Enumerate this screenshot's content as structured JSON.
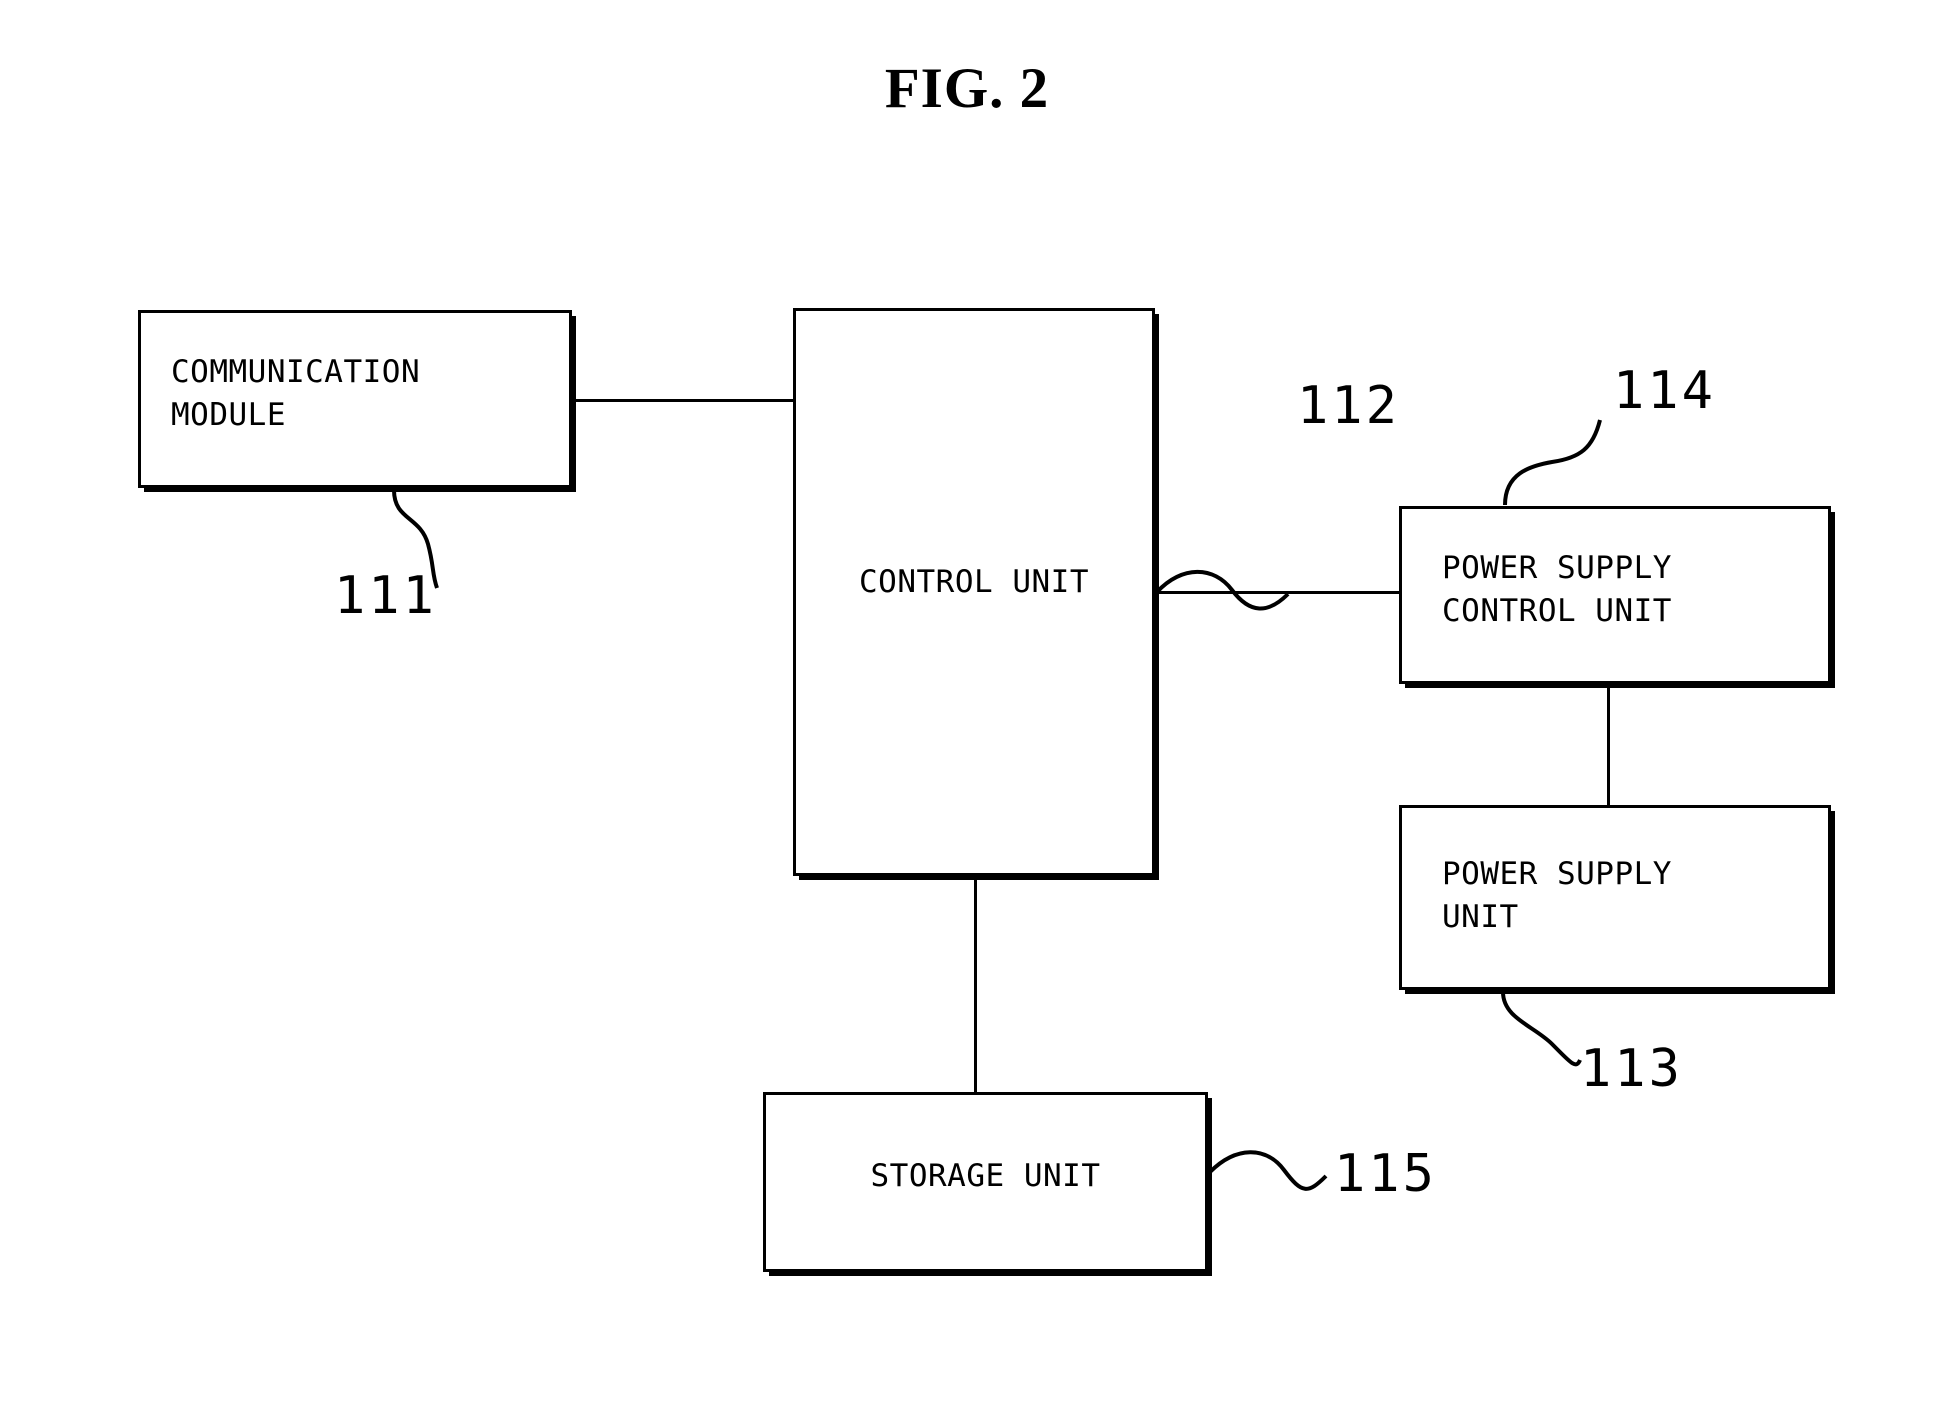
{
  "figure": {
    "title": "FIG. 2",
    "type": "patent-block-diagram"
  },
  "blocks": [
    {
      "id": "communication-module",
      "label": "COMMUNICATION\nMODULE",
      "reference_numeral": "111"
    },
    {
      "id": "control-unit",
      "label": "CONTROL UNIT",
      "reference_numeral": "112"
    },
    {
      "id": "power-supply-control-unit",
      "label": "POWER SUPPLY\nCONTROL UNIT",
      "reference_numeral": "114"
    },
    {
      "id": "power-supply-unit",
      "label": "POWER SUPPLY\nUNIT",
      "reference_numeral": "113"
    },
    {
      "id": "storage-unit",
      "label": "STORAGE UNIT",
      "reference_numeral": "115"
    }
  ],
  "reference_numerals": {
    "comm_module": "111",
    "control_unit": "112",
    "power_supply_unit": "113",
    "power_supply_control_unit": "114",
    "storage_unit": "115"
  },
  "connections": [
    {
      "from": "communication-module",
      "to": "control-unit",
      "orientation": "horizontal"
    },
    {
      "from": "control-unit",
      "to": "power-supply-control-unit",
      "orientation": "horizontal"
    },
    {
      "from": "power-supply-control-unit",
      "to": "power-supply-unit",
      "orientation": "vertical"
    },
    {
      "from": "control-unit",
      "to": "storage-unit",
      "orientation": "vertical"
    }
  ],
  "colors": {
    "line": "#000000",
    "background": "#ffffff",
    "text": "#000000"
  }
}
